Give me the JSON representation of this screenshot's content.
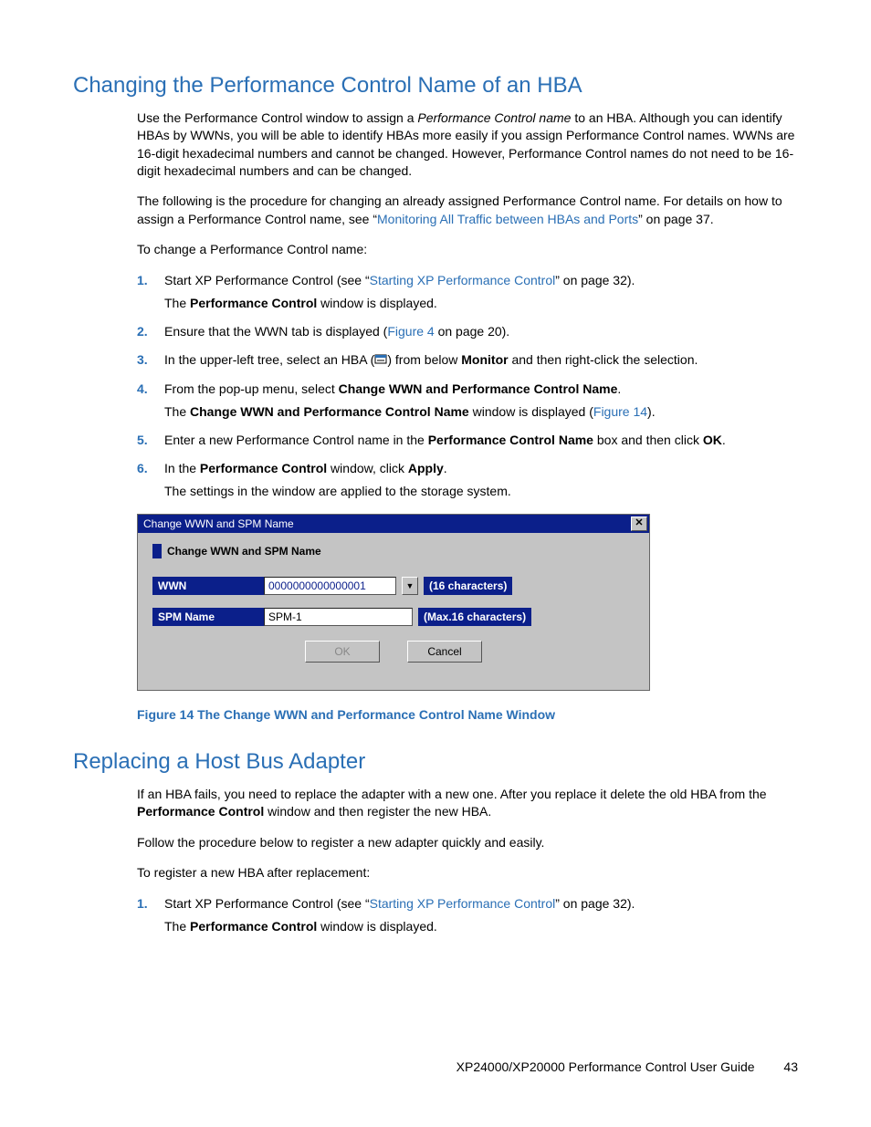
{
  "section1": {
    "title": "Changing the Performance Control Name of an HBA",
    "para1_a": "Use the Performance Control window to assign a ",
    "para1_em": "Performance Control name",
    "para1_b": " to an HBA. Although you can identify HBAs by WWNs, you will be able to identify HBAs more easily if you assign Performance Control names. WWNs are 16-digit hexadecimal numbers and cannot be changed. However, Performance Control names do not need to be 16-digit hexadecimal numbers and can be changed.",
    "para2_a": "The following is the procedure for changing an already assigned Performance Control name. For details on how to assign a Performance Control name, see “",
    "para2_link": "Monitoring All Traffic between HBAs and Ports",
    "para2_b": "” on page 37.",
    "para3": "To change a Performance Control name:",
    "steps": {
      "s1a": "Start XP Performance Control (see “",
      "s1link": "Starting XP Performance Control",
      "s1b": "” on page 32).",
      "s1sub_a": "The ",
      "s1sub_b": "Performance Control",
      "s1sub_c": " window is displayed.",
      "s2a": "Ensure that the WWN tab is displayed (",
      "s2link": "Figure 4",
      "s2b": " on page 20).",
      "s3a": "In the upper-left tree, select an HBA (",
      "s3b": ") from below ",
      "s3bold": "Monitor",
      "s3c": " and then right-click the selection.",
      "s4a": "From the pop-up menu, select ",
      "s4bold": "Change WWN and Performance Control Name",
      "s4b": ".",
      "s4sub_a": "The ",
      "s4sub_b": "Change WWN and Performance Control Name",
      "s4sub_c": " window is displayed (",
      "s4sub_link": "Figure 14",
      "s4sub_d": ").",
      "s5a": "Enter a new Performance Control name in the ",
      "s5bold": "Performance Control Name",
      "s5b": " box and then click ",
      "s5bold2": "OK",
      "s5c": ".",
      "s6a": "In the ",
      "s6bold": "Performance Control",
      "s6b": " window, click ",
      "s6bold2": "Apply",
      "s6c": ".",
      "s6sub": "The settings in the window are applied to the storage system."
    }
  },
  "dialog": {
    "title": "Change WWN and SPM Name",
    "panelTitle": "Change WWN and SPM Name",
    "wwnLabel": "WWN",
    "wwnValue": "0000000000000001",
    "wwnHint": "(16 characters)",
    "spmLabel": "SPM Name",
    "spmValue": "SPM-1",
    "spmHint": "(Max.16 characters)",
    "ok": "OK",
    "cancel": "Cancel"
  },
  "figcap": "Figure 14 The Change WWN and Performance Control Name Window",
  "section2": {
    "title": "Replacing a Host Bus Adapter",
    "para1_a": "If an HBA fails, you need to replace the adapter with a new one. After you replace it delete the old HBA from the ",
    "para1_b": "Performance Control",
    "para1_c": " window and then register the new HBA.",
    "para2": "Follow the procedure below to register a new adapter quickly and easily.",
    "para3": "To register a new HBA after replacement:",
    "steps": {
      "s1a": "Start XP Performance Control (see “",
      "s1link": "Starting XP Performance Control",
      "s1b": "” on page 32).",
      "s1sub_a": "The ",
      "s1sub_b": "Performance Control",
      "s1sub_c": " window is displayed."
    }
  },
  "footer": {
    "text": "XP24000/XP20000 Performance Control User Guide",
    "page": "43"
  }
}
